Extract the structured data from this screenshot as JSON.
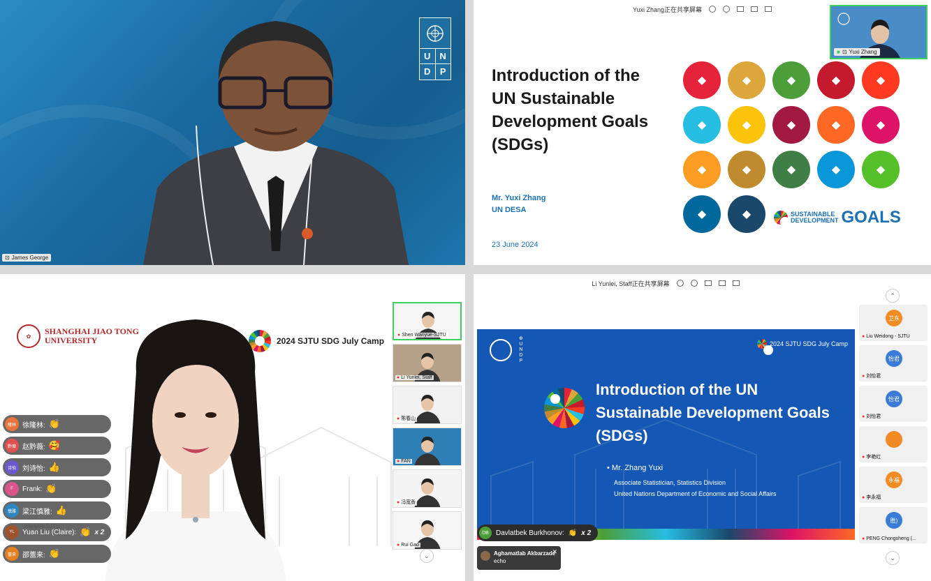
{
  "tiles": {
    "q1": {
      "name": "James George",
      "org_letters": [
        "U",
        "N",
        "D",
        "P"
      ]
    },
    "q2": {
      "share_label": "Yuxi Zhang正在共享屏幕",
      "title": "Introduction of the UN Sustainable Development Goals (SDGs)",
      "presenter": "Mr. Yuxi Zhang",
      "org": "UN DESA",
      "date": "23 June 2024",
      "logo_small_1": "SUSTAINABLE",
      "logo_small_2": "DEVELOPMENT",
      "logo_big": "GOALS",
      "selfview_name": "Yuxi Zhang",
      "sdg_colors": [
        "#e5243b",
        "#dda63a",
        "#4c9f38",
        "#c5192d",
        "#ff3a21",
        "#26bde2",
        "#fcc30b",
        "#a21942",
        "#fd6925",
        "#dd1367",
        "#fd9d24",
        "#bf8b2e",
        "#3f7e44",
        "#0a97d9",
        "#56c02b",
        "#00689d",
        "#19486a"
      ]
    },
    "q3": {
      "uni_line1": "SHANGHAI JIAO TONG",
      "uni_line2": "UNIVERSITY",
      "camp": "2024 SJTU SDG July Camp",
      "reactions": [
        {
          "name": "徐隆林:",
          "emoji": "👏",
          "count": "",
          "color": "#e8743b",
          "av": "隆林"
        },
        {
          "name": "赵黔薇:",
          "emoji": "🥰",
          "count": "",
          "color": "#e05050",
          "av": "黔薇"
        },
        {
          "name": "刘诗怡:",
          "emoji": "👍",
          "count": "",
          "color": "#6a5acd",
          "av": "诗怡"
        },
        {
          "name": "Frank:",
          "emoji": "👏",
          "count": "",
          "color": "#d9558a",
          "av": "F"
        },
        {
          "name": "梁江慎雅:",
          "emoji": "👍",
          "count": "",
          "color": "#2e86c1",
          "av": "慎雅"
        },
        {
          "name": "Yuan Liu (Claire):",
          "emoji": "👏",
          "count": "x 2",
          "color": "#a0522d",
          "av": "YL"
        },
        {
          "name": "邵蕾来:",
          "emoji": "👏",
          "count": "",
          "color": "#e67e22",
          "av": "蕾来"
        }
      ],
      "overlay_line": "Wanyue-SJTU",
      "thumbs": [
        {
          "label": "Shen Wanyue-SJTU"
        },
        {
          "label": "Li Yunlei, Staff"
        },
        {
          "label": "陈春山"
        },
        {
          "label": "FAN"
        },
        {
          "label": "冯宽香"
        },
        {
          "label": "Rui Gao"
        }
      ]
    },
    "q4": {
      "share_label": "Li Yunlei, Staff正在共享屏幕",
      "camp": "2024 SJTU SDG July Camp",
      "title": "Introduction of the UN Sustainable Development Goals (SDGs)",
      "bullet": "•  Mr. Zhang Yuxi",
      "role": "Associate Statistician, Statistics Division",
      "dept": "United Nations Department of Economic and Social Affairs",
      "toast_av": "DB",
      "toast_name": "Davlatbek  Burkhonov:",
      "toast_emoji": "👏",
      "toast_count": "x 2",
      "chat_name": "Aghamatlab Akbarzade",
      "chat_msg": "echo",
      "participants": [
        {
          "av": "卫东",
          "color": "#f28b24",
          "label": "Liu Weidong - SJTU"
        },
        {
          "av": "怡君",
          "color": "#3a7bd5",
          "label": "刘怡君"
        },
        {
          "av": "怡君",
          "color": "#3a7bd5",
          "label": "刘怡君"
        },
        {
          "av": "",
          "color": "#f28b24",
          "label": "李艳红"
        },
        {
          "av": "永福",
          "color": "#f28b24",
          "label": "李永福"
        },
        {
          "av": "胜)",
          "color": "#3a7bd5",
          "label": "PENG Chongsheng (..."
        }
      ]
    }
  }
}
